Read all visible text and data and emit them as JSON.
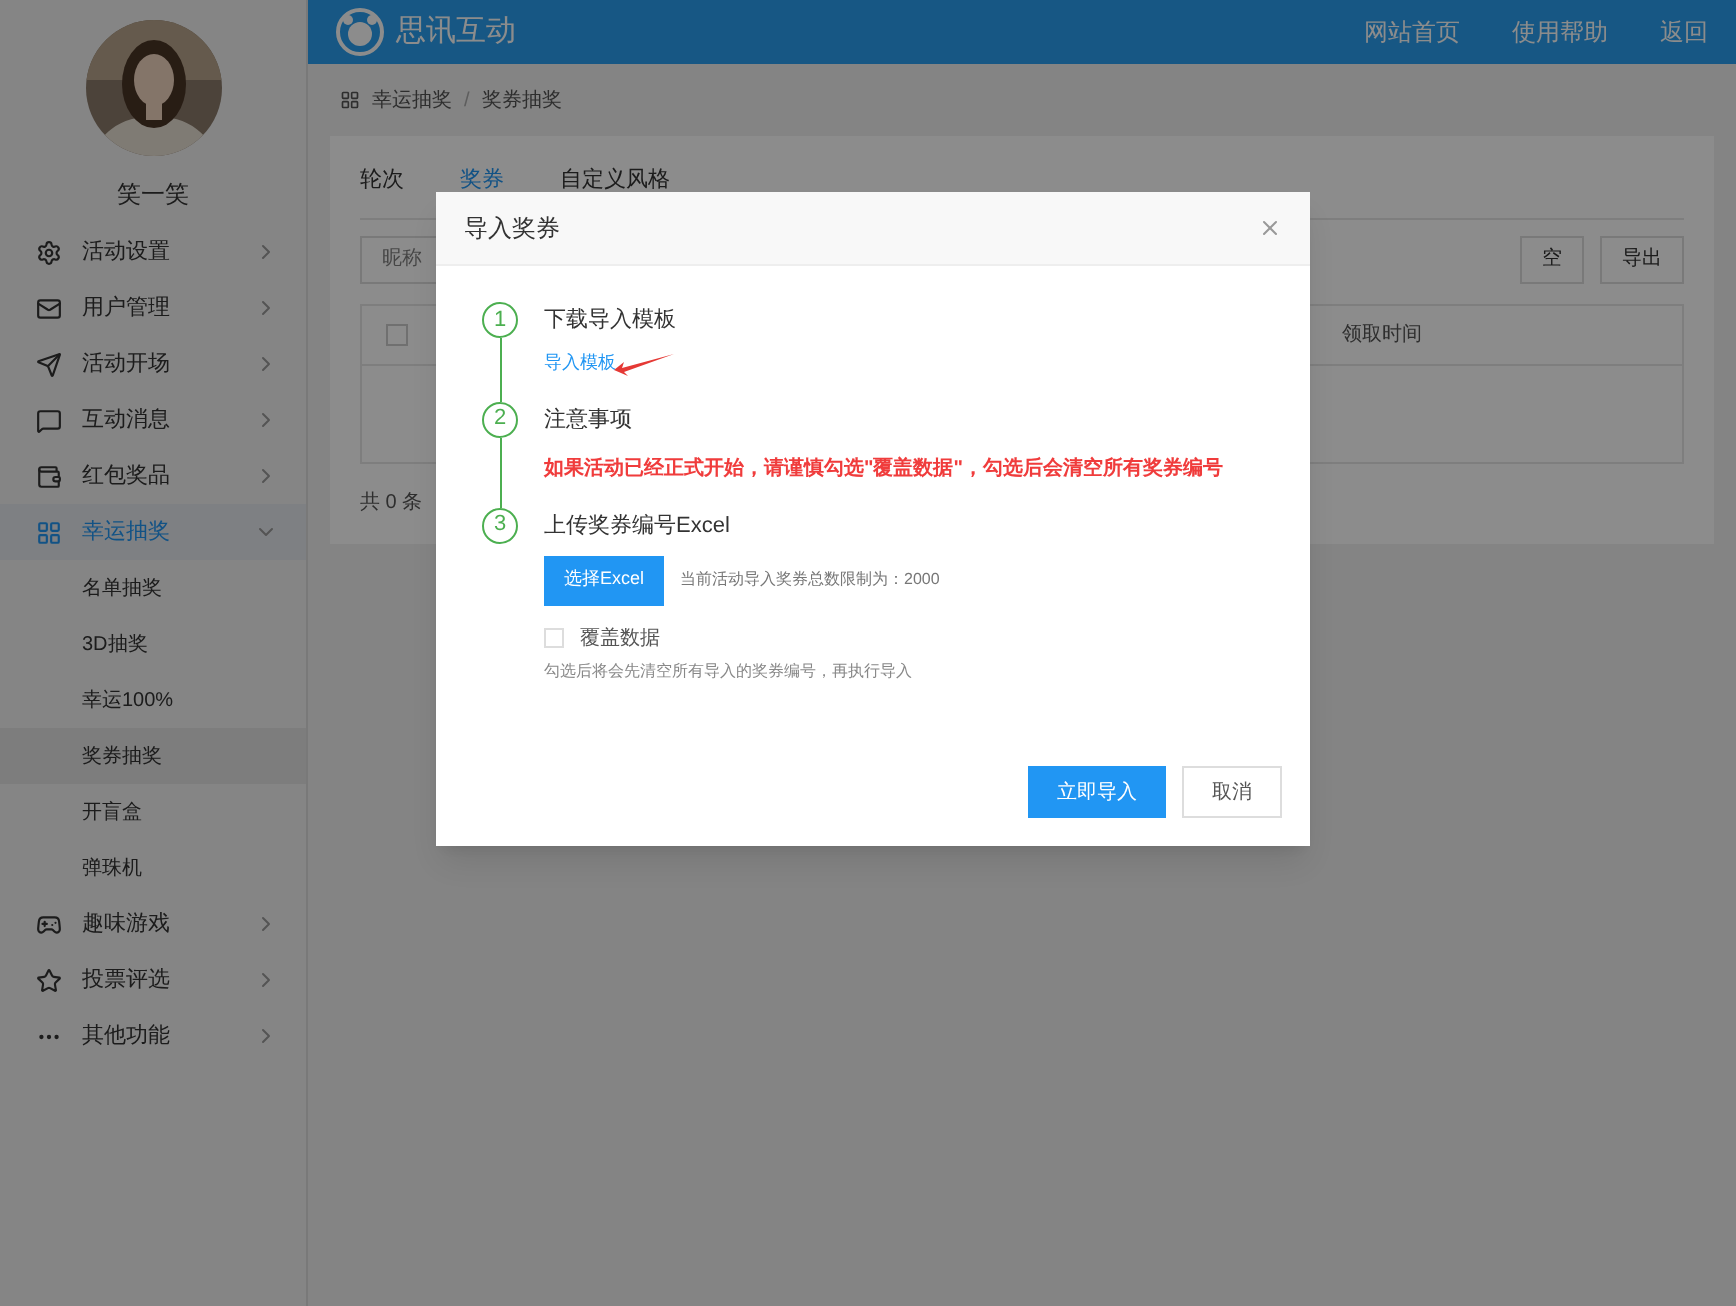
{
  "header": {
    "brand": "思讯互动",
    "links": [
      "网站首页",
      "使用帮助",
      "返回"
    ]
  },
  "sidebar": {
    "user_name": "笑一笑",
    "items": [
      {
        "label": "活动设置",
        "expanded": false,
        "selected": false
      },
      {
        "label": "用户管理",
        "expanded": false,
        "selected": false
      },
      {
        "label": "活动开场",
        "expanded": false,
        "selected": false
      },
      {
        "label": "互动消息",
        "expanded": false,
        "selected": false
      },
      {
        "label": "红包奖品",
        "expanded": false,
        "selected": false
      },
      {
        "label": "幸运抽奖",
        "expanded": true,
        "selected": true,
        "children": [
          {
            "label": "名单抽奖",
            "selected": false
          },
          {
            "label": "3D抽奖",
            "selected": false
          },
          {
            "label": "幸运100%",
            "selected": false
          },
          {
            "label": "奖券抽奖",
            "selected": true
          },
          {
            "label": "开盲盒",
            "selected": false
          },
          {
            "label": "弹珠机",
            "selected": false
          }
        ]
      },
      {
        "label": "趣味游戏",
        "expanded": false,
        "selected": false
      },
      {
        "label": "投票评选",
        "expanded": false,
        "selected": false
      },
      {
        "label": "其他功能",
        "expanded": false,
        "selected": false
      }
    ]
  },
  "breadcrumb": {
    "items": [
      "幸运抽奖",
      "奖券抽奖"
    ],
    "separator": "/"
  },
  "panel": {
    "tabs": [
      {
        "label": "轮次",
        "selected": false
      },
      {
        "label": "奖券",
        "selected": true
      },
      {
        "label": "自定义风格",
        "selected": false
      }
    ],
    "filter": {
      "placeholder": "昵称"
    },
    "buttons": [
      "空",
      "导出"
    ],
    "table": {
      "columns": [
        "领取时间"
      ],
      "header_checked": false
    },
    "total": "共 0 条"
  },
  "dialog": {
    "title": "导入奖券",
    "steps": [
      {
        "kind": "download",
        "number": "1",
        "title": "下载导入模板",
        "link": "导入模板"
      },
      {
        "kind": "notice",
        "number": "2",
        "title": "注意事项",
        "warning": "如果活动已经正式开始，请谨慎勾选\"覆盖数据\"，勾选后会清空所有奖券编号"
      },
      {
        "kind": "upload",
        "number": "3",
        "title": "上传奖券编号Excel",
        "button": "选择Excel",
        "limit": "当前活动导入奖券总数限制为：2000",
        "checkbox": {
          "label": "覆盖数据",
          "checked": false
        },
        "hint": "勾选后将会先清空所有导入的奖券编号，再执行导入"
      }
    ],
    "buttons": [
      {
        "label": "立即导入",
        "kind": "primary"
      },
      {
        "label": "取消",
        "kind": "default"
      }
    ]
  }
}
